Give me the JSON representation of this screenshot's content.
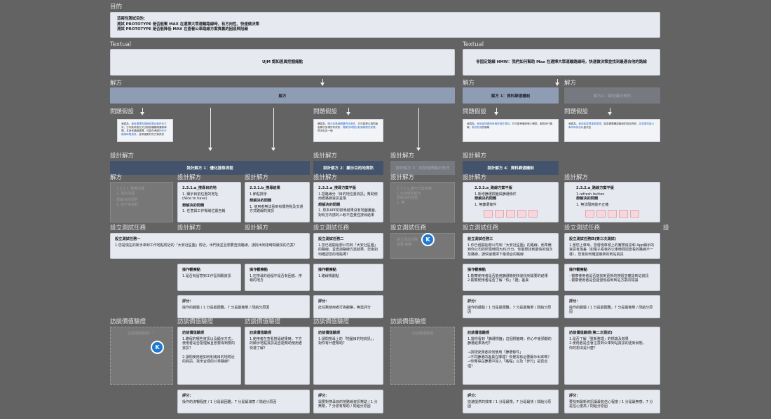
{
  "sections": {
    "goal": "目的",
    "textual": "Textual",
    "solution": "解方",
    "hypothesis": "問題假設",
    "design": "設計解方",
    "task": "設立測試任務",
    "interview": "訪談價值驗證"
  },
  "goal_box": {
    "l1": "這兩性測試目的：",
    "l2": "測試 PROTOTYPE 是否能幫 MAX 在選擇大眾運輸路線時，有方向性、快速做決策",
    "l3": "測試 PROTOTYPE 是否能降低 MAX 在查看公車路線方案資裏的困惑與阻礙"
  },
  "textual_left": "UJM 認知差異挖掘痛點",
  "textual_right": "非固定路線 HMW：我們如何幫助 Max 在選擇大眾運輸路線時，快速做決策並找到最適合他的路線",
  "solution_left": "解方",
  "solution_r1": "解方 1：資料篩選機制",
  "solution_r2": "解方4：個化顯示資訊",
  "hypo": {
    "h1a": "我認為，",
    "h1b": "最後選擇的路線時要比較許多方案",
    "h1c": "，它可能考慮交叉比較各種路線通勤時間、本身有路線選擇，",
    "h1d": "可能在考慮",
    "h1e": "的步行路線時間過長",
    "h1f": "，並希望更好的方案資訊",
    "h2a": "確認為，",
    "h2b": "顯示各路線關鍵資訊過多",
    "h2c": "，它可能是以相同版面層次呈現所有資訊，",
    "h2d": "需要花時間比較路線間的差異",
    "h2e": "，再決定出一個",
    "h3a": "我認為，",
    "h3b": "使用者搜尋時有偏好條件限制",
    "h3c": "，它可能會偏好較少轉乘、較短步行路線、",
    "h3d": "較快抵達",
    "h3e": "的路線",
    "h4a": "我認為，",
    "h4b": "使用者習慣重新整理",
    "h4c": "，因為需要確認最新的到站資訊，",
    "h4d": "並希望知道公車何時到站",
    "h4e": "以做決定"
  },
  "design": {
    "d1": "設計解方 1：優化搜尋流程",
    "d2": "設計解方 2：顯示目的地資訊",
    "d3": "設計解方 3：出發時間顯示資訊",
    "d4": "設計解方 4：資料篩選機制"
  },
  "sol_cards": {
    "c0t": "2.3.1.1_整體流程",
    "c0a": "1. 現有流程",
    "c0b": "想解決的問題",
    "c0c": "1. 找不到資料",
    "c1t": "2.3.1.a_搜尋目的地",
    "c1a": "1. 顯示目前位置的地址",
    "c1b": "(Nice to have)",
    "c1c": "想解決的問題",
    "c1d": "1. 任意與工作場域位置名稱",
    "c2t": "2.3.1.b_搜尋結果",
    "c2a": "1.節點排序",
    "c2b": "想解決的問題",
    "c2c": "1. 使用者無法看到有關地點及交通方式路線的資訊",
    "c3t": "2.3.2.a_搜尋方案平版",
    "c3a": "1.把路線分「目的地位置資訊」幫助使用者路線資訊呈現",
    "c3b": "想解決的問題",
    "c3c": "1. 原本APP的搜尋結果沒有地圖畫面，對有方向感的人較不直覺性搜尋結果",
    "c4t": "2.3.3.a_顯示方案平版",
    "c4a": "1.出發時間顯示",
    "c4b": "想解決的問題",
    "c4c": "1. 無",
    "c5t": "2.3.2.a_路線方案平版",
    "c5a": "1.新增篩選標籤與篩選條件",
    "c5b": "想解決的問題",
    "c5c": "1. 無篩選條件",
    "c6t": "2.3.2.a_路線方案平版",
    "c6a": "1.refresh button",
    "c6b": "想解決的問題",
    "c6c": "1. 無法隨時能不正確"
  },
  "tasks": {
    "t1t": "設立測試任務一",
    "t1b": "1.您是現在的新手來到工作地點附近的「大安社區園」附近，出門後並且想要查詢路線，請找出到達時間最快的方案？",
    "t2t": "設立測試任務二",
    "t2b": "1.您已經開始想公司到「大安社區園」的路線，並查詢路線方案結果，您會如何確認您的地點嗎？",
    "t3t": "設立測試任務",
    "t3b": "需要 相關",
    "t4t": "設立測試任務三",
    "t4b": "1.你已經開始想公司到「大安社區園」的路線，而準備到你公司的所需時間大約15分，你最想找到最快的班次及路線，請快速選擇下最適合的路線",
    "t5t": "設立測試任務四(第三次測試)",
    "t5b": "1.當您上車時，您發現車頭上的實際資訊和 App顯示的資訊有落差（如電子看板的公車時間與查看的路線不一樣），您會如何確認最新的到站資訊"
  },
  "ops": {
    "o1t": "操作觀察點",
    "o1b": "1.是否有留意到工作區相關資訊",
    "o2t": "操作觀察點",
    "o2b": "1.在搜尋的過程中是否有困惑、停頓的地方",
    "o3t": "操作觀察點",
    "o3b": "1.路線規劃點",
    "o4t": "操作觀察點",
    "o4b": "1.觀察使用者是否能用篩選機制快速找到需要的結果\n2.觀察使用者是否了解「快」「捷」差異",
    "o5t": "操作觀察點",
    "o5b": "- 觀察使用者是否能找到更新的按鈕並確認到站資訊\n- 觀察使用者是否能發現看到到站方案的標識"
  },
  "scores": {
    "s_t": "評分：",
    "s1": "操作的體驗 / 1 分是最困難，7 分是最簡單 / 問給分原因",
    "s2": "此任務使用者行為觀察，無需評分",
    "s3": "操作的體驗 / 1 分是最困難，7 分是最簡單 / 問給分原因",
    "s4": "操作的體驗 / 1 分是最困難，7 分是最簡單 / 問給分原因",
    "s5": "操作的流暢程度 / 1 分是最困難，7 分是最滿意 / 問給分原因",
    "s6": "需要對搜尋目的地路線資訊幫助 / 1 分無幫，7 分很有幫助 / 問給分原因",
    "s7": "快速提供的效率 / 1 分是最慢，7 分是最快 / 問給分原因",
    "s8": "要找到最新資訊讓最有信心程度 / 1 分是最無感，7 分是信心度高 / 問給分原因"
  },
  "interviews": {
    "g1": "訪談價值驗證？？",
    "i1t": "訪談價值驗證",
    "i1b": "1.路程的哪些資訊以及顯示方式，使用者是否能理解且想要得到要的資訊？\n\n2.請問使用者如何利用目的地附近的資訊，找出合適的公車路線？",
    "i2t": "訪談價值驗證",
    "i2b": "1.使用者在查看搜尋結果時，下方的顯示地點資訊是否能幫助使用者快速了解？",
    "i3t": "訪談價值驗證",
    "i3b": "1.請問搜尋上的「地圖目的地資訊」，對你有什麼幫助？",
    "g2": "訪談價值驗證",
    "i4t": "訪談價值驗證",
    "i4b": "1.當你看到「篩選標籤」這個標籤時，你心中會預期的篩選結果為何？\n\n→詢問受測者如何使用「篩選條件」\n→不同篩選的差異在哪裡？你覺得有必要顯示出來嗎？\n→你覺得在篩選中加入「路程」以及「步行」是否合理？",
    "i5t": "訪談價值驗證(第二次測試)",
    "i5b": "1.是否了解「重新整理」的標識及效果\n2.使用者是否會注意到公車到站資訊的更新狀態，\n你的想法是什麼？"
  }
}
